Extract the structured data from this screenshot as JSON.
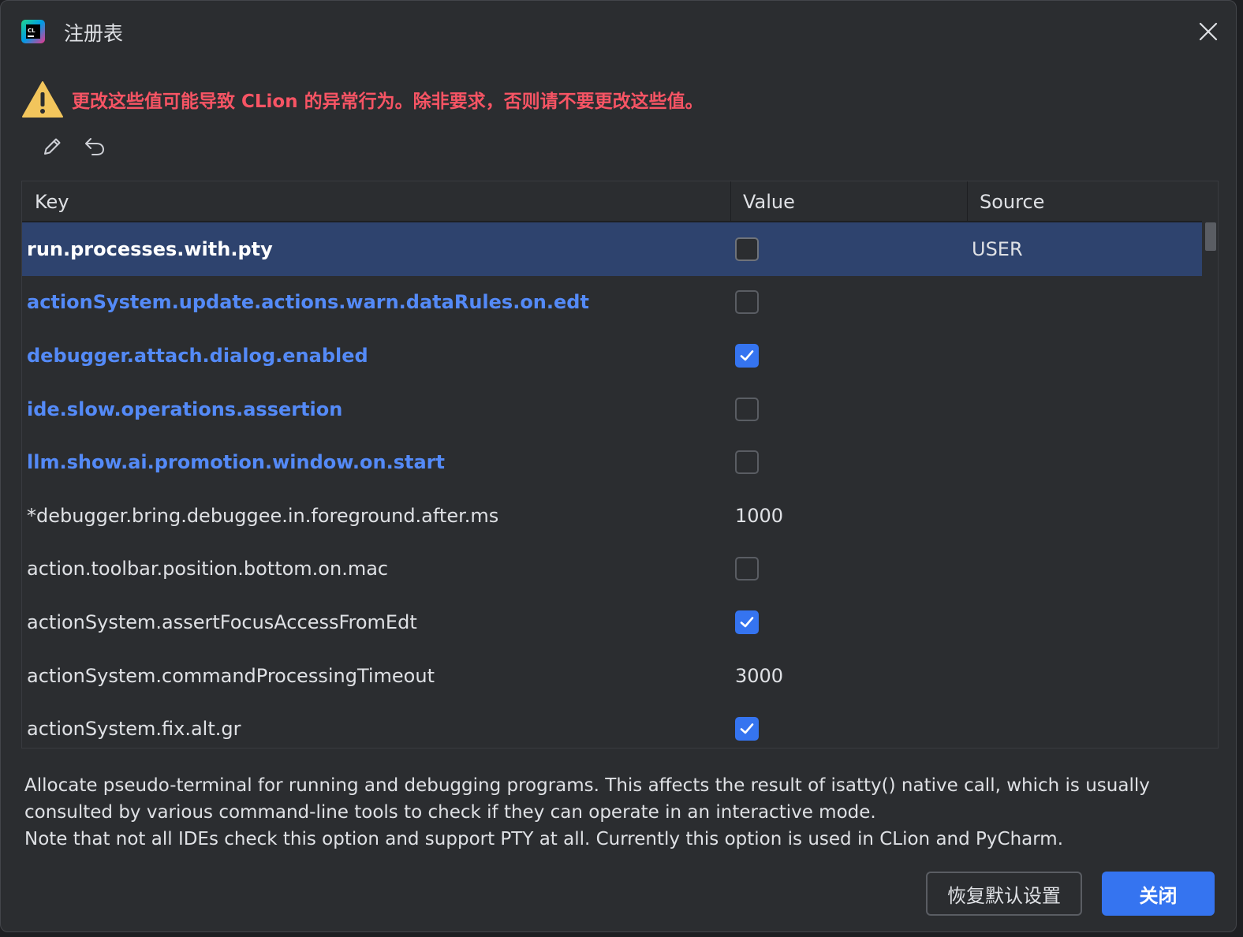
{
  "window": {
    "title": "注册表"
  },
  "warning": {
    "text": "更改这些值可能导致 CLion 的异常行为。除非要求，否则请不要更改这些值。",
    "color": "#f75464"
  },
  "toolbar": {
    "icons": [
      "pencil-icon",
      "undo-icon"
    ]
  },
  "table": {
    "headers": {
      "key": "Key",
      "value": "Value",
      "source": "Source"
    },
    "rows": [
      {
        "key": "run.processes.with.pty",
        "value_type": "checkbox",
        "checked": false,
        "source": "USER",
        "style": "selected"
      },
      {
        "key": "actionSystem.update.actions.warn.dataRules.on.edt",
        "value_type": "checkbox",
        "checked": false,
        "source": "",
        "style": "modified"
      },
      {
        "key": "debugger.attach.dialog.enabled",
        "value_type": "checkbox",
        "checked": true,
        "source": "",
        "style": "modified"
      },
      {
        "key": "ide.slow.operations.assertion",
        "value_type": "checkbox",
        "checked": false,
        "source": "",
        "style": "modified"
      },
      {
        "key": "llm.show.ai.promotion.window.on.start",
        "value_type": "checkbox",
        "checked": false,
        "source": "",
        "style": "modified"
      },
      {
        "key": "*debugger.bring.debuggee.in.foreground.after.ms",
        "value_type": "text",
        "value": "1000",
        "source": "",
        "style": "normal"
      },
      {
        "key": "action.toolbar.position.bottom.on.mac",
        "value_type": "checkbox",
        "checked": false,
        "source": "",
        "style": "normal"
      },
      {
        "key": "actionSystem.assertFocusAccessFromEdt",
        "value_type": "checkbox",
        "checked": true,
        "source": "",
        "style": "normal"
      },
      {
        "key": "actionSystem.commandProcessingTimeout",
        "value_type": "text",
        "value": "3000",
        "source": "",
        "style": "normal"
      },
      {
        "key": "actionSystem.fix.alt.gr",
        "value_type": "checkbox",
        "checked": true,
        "source": "",
        "style": "normal"
      }
    ]
  },
  "description": {
    "lines": [
      "Allocate pseudo-terminal for running and debugging programs. This affects the result of isatty() native call, which is usually consulted by various command-line tools to check if they can operate in an interactive mode.",
      "Note that not all IDEs check this option and support PTY at all. Currently this option is used in CLion and PyCharm."
    ]
  },
  "buttons": {
    "restore_label": "恢复默认设置",
    "close_label": "关闭"
  },
  "colors": {
    "accent": "#3574f0",
    "modified_key": "#548af7",
    "selected_row": "#2e436e",
    "background": "#2b2d30"
  }
}
